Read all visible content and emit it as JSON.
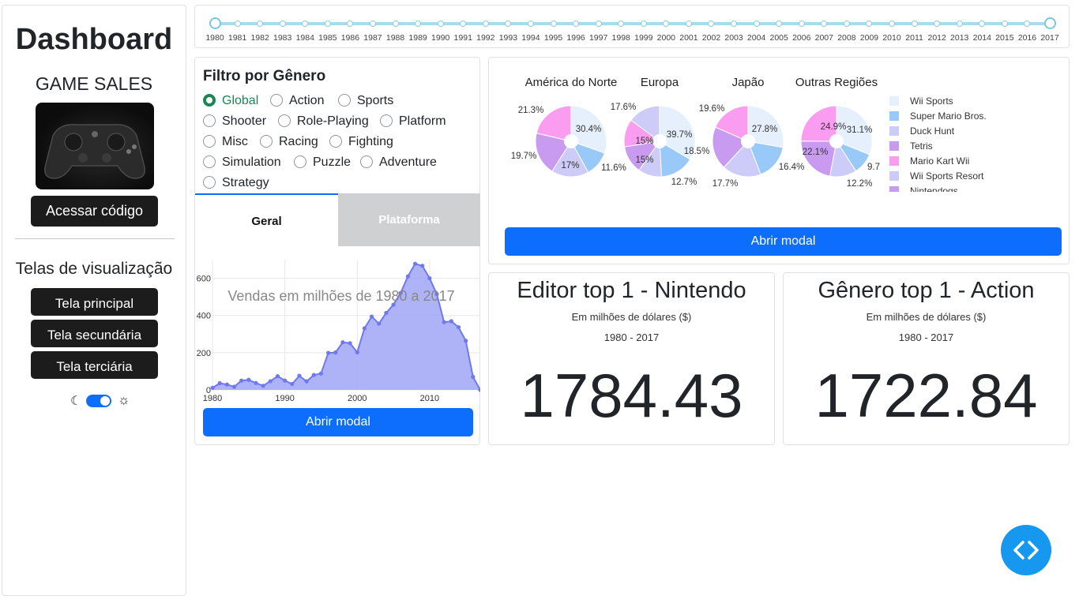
{
  "sidebar": {
    "title": "Dashboard",
    "subtitle": "GAME SALES",
    "code_button": "Acessar código",
    "views_label": "Telas de visualização",
    "views": [
      "Tela principal",
      "Tela secundária",
      "Tela terciária"
    ],
    "theme_toggle": {
      "state": "on"
    }
  },
  "year_slider": {
    "years": [
      "1980",
      "1981",
      "1982",
      "1983",
      "1984",
      "1985",
      "1986",
      "1987",
      "1988",
      "1989",
      "1990",
      "1991",
      "1992",
      "1993",
      "1994",
      "1995",
      "1996",
      "1997",
      "1998",
      "1999",
      "2000",
      "2001",
      "2002",
      "2003",
      "2004",
      "2005",
      "2006",
      "2007",
      "2008",
      "2009",
      "2010",
      "2011",
      "2012",
      "2013",
      "2014",
      "2015",
      "2016",
      "2017"
    ],
    "range": [
      "1980",
      "2017"
    ]
  },
  "genre_filter": {
    "title": "Filtro por Gênero",
    "options": [
      "Global",
      "Action",
      "Sports",
      "Shooter",
      "Role-Playing",
      "Platform",
      "Misc",
      "Racing",
      "Fighting",
      "Simulation",
      "Puzzle",
      "Adventure",
      "Strategy"
    ],
    "selected": "Global",
    "tabs": [
      "Geral",
      "Plataforma"
    ],
    "active_tab": "Geral",
    "modal_button": "Abrir modal"
  },
  "pie_panel": {
    "modal_button": "Abrir modal",
    "legend": [
      "Wii Sports",
      "Super Mario Bros.",
      "Duck Hunt",
      "Tetris",
      "Mario Kart Wii",
      "Wii Sports Resort",
      "Nintendogs"
    ],
    "colors": {
      "Wii Sports": "#e6f0fd",
      "Super Mario Bros.": "#99c9f8",
      "Duck Hunt": "#cdcbf7",
      "Tetris": "#c89bf1",
      "Mario Kart Wii": "#fa9df1",
      "Wii Sports Resort": "#cdcbf7",
      "Nintendogs": "#c89bf1"
    }
  },
  "kpis": [
    {
      "title": "Editor top 1 - Nintendo",
      "subtitle": "Em milhões de dólares ($)",
      "period": "1980 - 2017",
      "value": "1784.43"
    },
    {
      "title": "Gênero top 1 - Action",
      "subtitle": "Em milhões de dólares ($)",
      "period": "1980 - 2017",
      "value": "1722.84"
    }
  ],
  "chart_data": [
    {
      "type": "area",
      "title": "Vendas em milhões de 1980 a 2017",
      "x": [
        1980,
        1981,
        1982,
        1983,
        1984,
        1985,
        1986,
        1987,
        1988,
        1989,
        1990,
        1991,
        1992,
        1993,
        1994,
        1995,
        1996,
        1997,
        1998,
        1999,
        2000,
        2001,
        2002,
        2003,
        2004,
        2005,
        2006,
        2007,
        2008,
        2009,
        2010,
        2011,
        2012,
        2013,
        2014,
        2015,
        2016,
        2017
      ],
      "y": [
        11,
        36,
        29,
        17,
        50,
        54,
        37,
        22,
        47,
        74,
        50,
        32,
        76,
        46,
        80,
        88,
        199,
        201,
        256,
        251,
        202,
        331,
        394,
        356,
        414,
        458,
        521,
        610,
        678,
        667,
        600,
        515,
        364,
        369,
        337,
        264,
        70,
        0.05
      ],
      "xticks": [
        "1980",
        "1990",
        "2000",
        "2010"
      ],
      "yticks": [
        "0",
        "200",
        "400",
        "600"
      ],
      "ylim": [
        0,
        700
      ],
      "color": "#6e79f0",
      "fill": "#a5aaf6",
      "grid": true
    },
    {
      "type": "pie",
      "titles": [
        "América do Norte",
        "Europa",
        "Japão",
        "Outras Regiões"
      ],
      "series": [
        {
          "slices": [
            30.4,
            11.6,
            17,
            19.7,
            21.3
          ]
        },
        {
          "slices": [
            39.7,
            18.5,
            12.7,
            15,
            15,
            17.6
          ]
        },
        {
          "slices": [
            27.8,
            16.4,
            17.7,
            19.6,
            18.5
          ]
        },
        {
          "slices": [
            31.1,
            9.7,
            12.2,
            22.1,
            24.9
          ]
        }
      ],
      "labels": [
        [
          "30.4%",
          "11.6%",
          "17%",
          "19.7%",
          "21.3%"
        ],
        [
          "39.7%",
          "18.5%",
          "12.7%",
          "15%",
          "15%",
          "17.6%"
        ],
        [
          "27.8%",
          "16.4%",
          "17.7%",
          "19.6%"
        ],
        [
          "31.1%",
          "9.7",
          "12.2%",
          "22.1%",
          "24.9%"
        ]
      ]
    }
  ]
}
